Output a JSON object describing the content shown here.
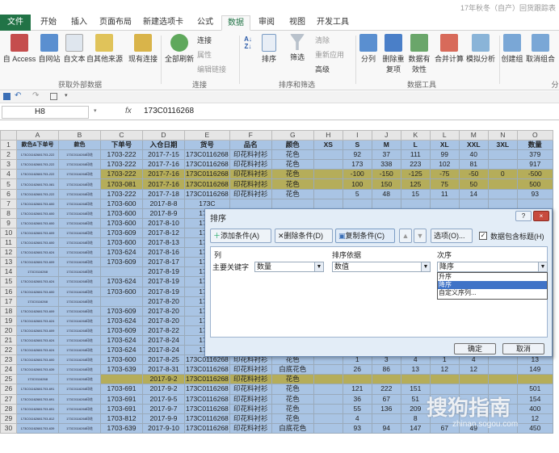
{
  "window": {
    "title": "17年秋冬（自产）回货跟踪表"
  },
  "tabs": [
    {
      "label": "文件"
    },
    {
      "label": "开始"
    },
    {
      "label": "插入"
    },
    {
      "label": "页面布局"
    },
    {
      "label": "新建选项卡"
    },
    {
      "label": "公式"
    },
    {
      "label": "数据"
    },
    {
      "label": "审阅"
    },
    {
      "label": "视图"
    },
    {
      "label": "开发工具"
    }
  ],
  "ribbon": {
    "access": "自 Access",
    "web": "自网站",
    "text": "自文本",
    "other": "自其他来源",
    "existing": "现有连接",
    "refresh": "全部刷新",
    "connections": "连接",
    "properties": "属性",
    "edit_links": "编辑链接",
    "sort": "排序",
    "filter": "筛选",
    "clear": "清除",
    "reapply": "重新应用",
    "advanced": "高级",
    "split": "分列",
    "remove_dup": "删除重复项",
    "validation": "数据有效性",
    "consolidate": "合并计算",
    "whatif": "模拟分析",
    "group": "创建组",
    "ungroup": "取消组合",
    "subtotal": "分",
    "g_external": "获取外部数据",
    "g_conn": "连接",
    "g_sort": "排序和筛选",
    "g_tools": "数据工具"
  },
  "formula_bar": {
    "name_box": "H8",
    "fx": "fx",
    "value": "173C0116268"
  },
  "grid": {
    "col_headers": [
      "A",
      "B",
      "C",
      "D",
      "E",
      "F",
      "G",
      "H",
      "I",
      "J",
      "K",
      "L",
      "M",
      "N",
      "O"
    ],
    "header_row": [
      "款色&下单号",
      "款色",
      "下单号",
      "入仓日期",
      "货号",
      "品名",
      "颜色",
      "XS",
      "S",
      "M",
      "L",
      "XL",
      "XXL",
      "3XL",
      "数量"
    ],
    "rows": [
      [
        "2",
        "173C01162681703-222",
        "173C0116268印花",
        "1703-222",
        "2017-7-15",
        "173C0116268",
        "印花料衬衫",
        "花色",
        "",
        "92",
        "37",
        "111",
        "99",
        "40",
        "",
        "379"
      ],
      [
        "3",
        "173C01162681703-222",
        "173C0116268印花",
        "1703-222",
        "2017-7-16",
        "173C0116268",
        "印花料衬衫",
        "花色",
        "",
        "173",
        "338",
        "223",
        "102",
        "81",
        "",
        "917"
      ],
      [
        "4",
        "173C01162681703-222",
        "173C0116268印花",
        "1703-222",
        "2017-7-16",
        "173C0116268",
        "印花料衬衫",
        "花色",
        "",
        "-100",
        "-150",
        "-125",
        "-75",
        "-50",
        "0",
        "-500"
      ],
      [
        "5",
        "173C01162681703-081",
        "173C0116268印花",
        "1703-081",
        "2017-7-16",
        "173C0116268",
        "印花料衬衫",
        "花色",
        "",
        "100",
        "150",
        "125",
        "75",
        "50",
        "",
        "500"
      ],
      [
        "6",
        "173C01162681703-222",
        "173C0116268印花",
        "1703-222",
        "2017-7-18",
        "173C0116268",
        "印花料衬衫",
        "花色",
        "",
        "5",
        "48",
        "15",
        "11",
        "14",
        "",
        "93"
      ],
      [
        "7",
        "173C01162681703-600",
        "173C0116268印花",
        "1703-600",
        "2017-8-8",
        "173C",
        "",
        "",
        "",
        "",
        "",
        "",
        "",
        "",
        "",
        ""
      ],
      [
        "8",
        "173C01162681703-600",
        "173C0116268印花",
        "1703-600",
        "2017-8-9",
        "173C",
        "",
        "",
        "",
        "",
        "",
        "",
        "",
        "",
        "",
        ""
      ],
      [
        "9",
        "173C01162681703-600",
        "173C0116268印花",
        "1703-600",
        "2017-8-10",
        "173C",
        "",
        "",
        "",
        "",
        "",
        "",
        "",
        "",
        "",
        ""
      ],
      [
        "10",
        "173C01162681703-609",
        "173C0116268印花",
        "1703-609",
        "2017-8-12",
        "173C",
        "",
        "",
        "",
        "",
        "",
        "",
        "",
        "",
        "",
        ""
      ],
      [
        "11",
        "173C01162681703-600",
        "173C0116268印花",
        "1703-600",
        "2017-8-13",
        "173C",
        "",
        "",
        "",
        "",
        "",
        "",
        "",
        "",
        "",
        ""
      ],
      [
        "12",
        "173C01162681703-624",
        "173C0116268印花",
        "1703-624",
        "2017-8-16",
        "173C",
        "",
        "",
        "",
        "",
        "",
        "",
        "",
        "",
        "",
        ""
      ],
      [
        "13",
        "173C01162681703-609",
        "173C0116268印花",
        "1703-609",
        "2017-8-17",
        "173C",
        "",
        "",
        "",
        "",
        "",
        "",
        "",
        "",
        "",
        ""
      ],
      [
        "14",
        "173C0116268",
        "173C0116268印花",
        "",
        "2017-8-19",
        "173C",
        "",
        "",
        "",
        "",
        "",
        "",
        "",
        "",
        "",
        ""
      ],
      [
        "15",
        "173C01162681703-624",
        "173C0116268印花",
        "1703-624",
        "2017-8-19",
        "173C",
        "",
        "",
        "",
        "",
        "",
        "",
        "",
        "",
        "",
        ""
      ],
      [
        "16",
        "173C01162681703-600",
        "173C0116268印花",
        "1703-600",
        "2017-8-19",
        "173C",
        "",
        "",
        "",
        "",
        "",
        "",
        "",
        "",
        "",
        ""
      ],
      [
        "17",
        "173C0116268",
        "173C0116268印花",
        "",
        "2017-8-20",
        "173C",
        "",
        "",
        "",
        "",
        "",
        "",
        "",
        "",
        "",
        ""
      ],
      [
        "18",
        "173C01162681703-609",
        "173C0116268印花",
        "1703-609",
        "2017-8-20",
        "173C",
        "",
        "",
        "",
        "",
        "",
        "",
        "",
        "",
        "",
        ""
      ],
      [
        "19",
        "173C01162681703-624",
        "173C0116268印花",
        "1703-624",
        "2017-8-20",
        "173C",
        "",
        "",
        "",
        "",
        "",
        "",
        "",
        "",
        "",
        ""
      ],
      [
        "20",
        "173C01162681703-609",
        "173C0116268印花",
        "1703-609",
        "2017-8-22",
        "173C",
        "",
        "",
        "",
        "",
        "",
        "",
        "",
        "",
        "",
        ""
      ],
      [
        "21",
        "173C01162681703-624",
        "173C0116268印花",
        "1703-624",
        "2017-8-24",
        "173C",
        "",
        "",
        "",
        "",
        "",
        "",
        "",
        "",
        "",
        ""
      ],
      [
        "22",
        "173C01162681703-624",
        "173C0116268印花",
        "1703-624",
        "2017-8-24",
        "173C",
        "",
        "",
        "",
        "",
        "",
        "",
        "",
        "",
        "",
        ""
      ],
      [
        "23",
        "173C01162681703-600",
        "173C0116268印花",
        "1703-600",
        "2017-8-25",
        "173C0116268",
        "印花料衬衫",
        "花色",
        "",
        "1",
        "3",
        "4",
        "1",
        "4",
        "",
        "13"
      ],
      [
        "24",
        "173C01162681703-639",
        "173C0116268印花",
        "1703-639",
        "2017-8-31",
        "173C0116268",
        "印花料衬衫",
        "白底花色",
        "",
        "26",
        "86",
        "13",
        "12",
        "12",
        "",
        "149"
      ],
      [
        "25",
        "173C0116268",
        "173C0116268印花",
        "",
        "2017-9-2",
        "173C0116268",
        "印花料衬衫",
        "花色",
        "",
        "",
        "",
        "",
        "",
        "",
        "",
        ""
      ],
      [
        "26",
        "173C01162681703-691",
        "173C0116268印花",
        "1703-691",
        "2017-9-2",
        "173C0116268",
        "印花料衬衫",
        "花色",
        "",
        "121",
        "222",
        "151",
        "",
        "",
        "",
        "501"
      ],
      [
        "27",
        "173C01162681703-691",
        "173C0116268印花",
        "1703-691",
        "2017-9-5",
        "173C0116268",
        "印花料衬衫",
        "花色",
        "",
        "36",
        "67",
        "51",
        "",
        "",
        "",
        "154"
      ],
      [
        "28",
        "173C01162681703-691",
        "173C0116268印花",
        "1703-691",
        "2017-9-7",
        "173C0116268",
        "印花料衬衫",
        "花色",
        "",
        "55",
        "136",
        "209",
        "",
        "",
        "",
        "400"
      ],
      [
        "29",
        "173C01162681703-812",
        "173C0116268印花",
        "1703-812",
        "2017-9-9",
        "173C0116268",
        "印花料衬衫",
        "花色",
        "",
        "4",
        "",
        "8",
        "",
        "",
        "",
        "12"
      ],
      [
        "30",
        "173C01162681703-639",
        "173C0116268印花",
        "1703-639",
        "2017-9-10",
        "173C0116268",
        "印花料衬衫",
        "白底花色",
        "",
        "93",
        "94",
        "147",
        "67",
        "49",
        "",
        "450"
      ]
    ]
  },
  "sort_dialog": {
    "title": "排序",
    "add_level": "添加条件(A)",
    "delete_level": "删除条件(D)",
    "copy_level": "复制条件(C)",
    "options": "选项(O)...",
    "has_headers": "数据包含标题(H)",
    "col_header": "列",
    "sort_on_header": "排序依据",
    "order_header": "次序",
    "row_label": "主要关键字",
    "column_value": "数量",
    "sort_on_value": "数值",
    "order_value": "降序",
    "order_options": [
      "升序",
      "降序",
      "自定义序列..."
    ],
    "ok": "确定",
    "cancel": "取消",
    "help": "?",
    "close": "×"
  },
  "watermark": {
    "text": "搜狗指南",
    "url": "zhinan.sogou.com"
  },
  "colors": {
    "accent": "#217346",
    "selection": "#a9c4e4",
    "olive": "#b5ad5a",
    "purple": "#8b3fc4"
  }
}
